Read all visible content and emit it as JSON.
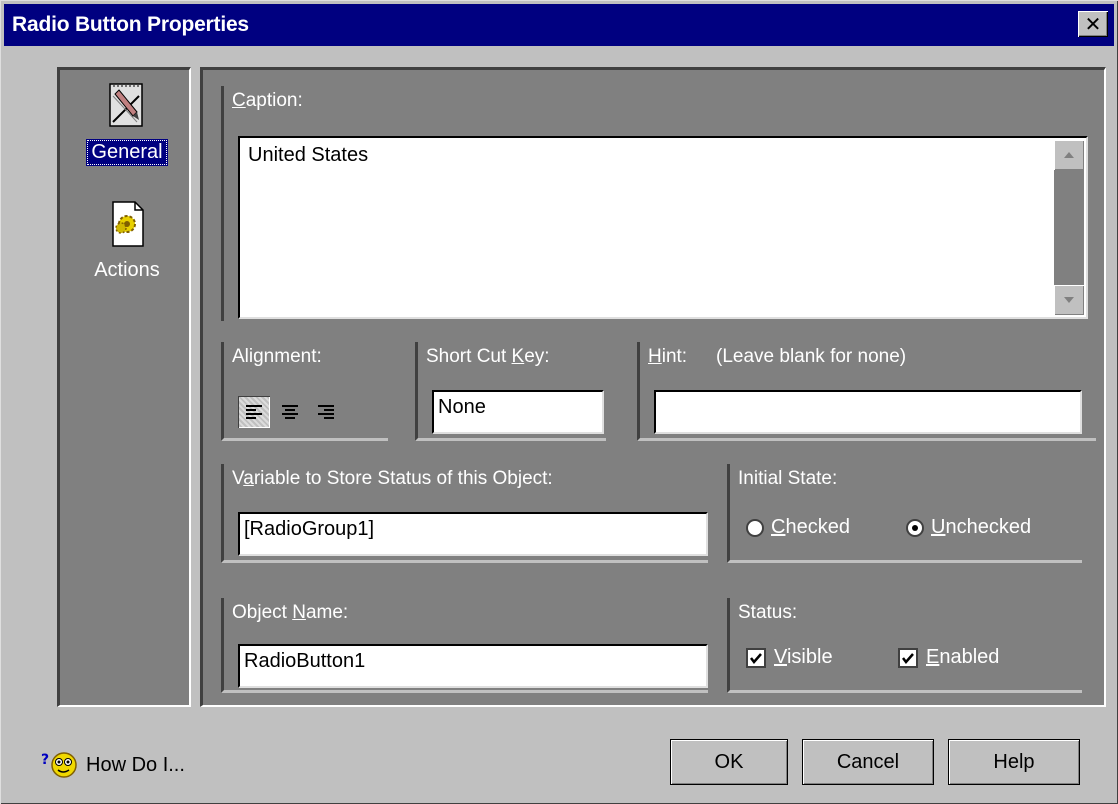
{
  "window": {
    "title": "Radio Button Properties",
    "close_glyph": "✕"
  },
  "sidebar": {
    "items": [
      {
        "label": "General",
        "icon": "general-properties-icon",
        "selected": true
      },
      {
        "label": "Actions",
        "icon": "actions-gear-icon",
        "selected": false
      }
    ]
  },
  "caption": {
    "label_u": "C",
    "label_rest": "aption:",
    "value": "United States"
  },
  "alignment": {
    "label": "Alignment:",
    "options": [
      "left",
      "center",
      "right"
    ],
    "selected": "left"
  },
  "shortcut": {
    "label_pre": "Short Cut ",
    "label_u": "K",
    "label_post": "ey:",
    "value": "None"
  },
  "hint": {
    "label_u": "H",
    "label_rest": "int:",
    "note": "(Leave blank for none)",
    "value": ""
  },
  "variable": {
    "label_pre": "V",
    "label_u": "a",
    "label_post": "riable to Store Status of this Object:",
    "value": "[RadioGroup1]"
  },
  "initial_state": {
    "label": "Initial State:",
    "options": [
      {
        "u": "C",
        "rest": "hecked",
        "selected": false
      },
      {
        "u": "U",
        "rest": "nchecked",
        "selected": true
      }
    ]
  },
  "object_name": {
    "label_pre": "Object ",
    "label_u": "N",
    "label_post": "ame:",
    "value": "RadioButton1"
  },
  "status": {
    "label": "Status:",
    "options": [
      {
        "u": "V",
        "rest": "isible",
        "checked": true
      },
      {
        "u": "E",
        "rest": "nabled",
        "checked": true
      }
    ]
  },
  "footer": {
    "howdo_label": "How Do I...",
    "ok_label": "OK",
    "cancel_label": "Cancel",
    "help_label": "Help"
  }
}
